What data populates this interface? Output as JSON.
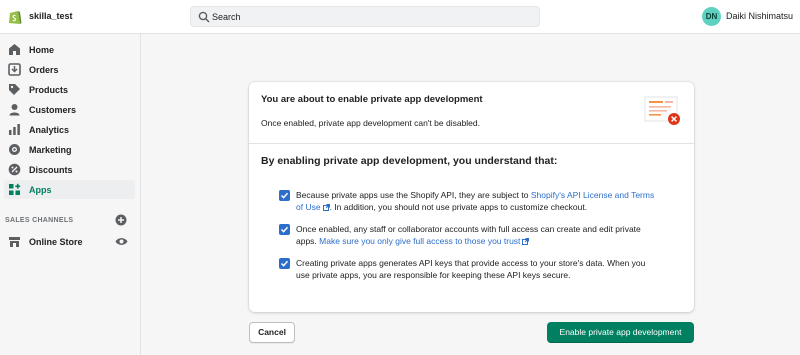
{
  "app": {
    "store_name": "skilla_test",
    "user_initials": "DN",
    "user_name": "Daiki Nishimatsu",
    "accent_color": "#008060",
    "link_color": "#2c6ecb"
  },
  "search": {
    "placeholder": "Search"
  },
  "sidebar": {
    "items": [
      {
        "label": "Home",
        "icon": "home-icon"
      },
      {
        "label": "Orders",
        "icon": "orders-icon"
      },
      {
        "label": "Products",
        "icon": "tag-icon"
      },
      {
        "label": "Customers",
        "icon": "person-icon"
      },
      {
        "label": "Analytics",
        "icon": "bar-chart-icon"
      },
      {
        "label": "Marketing",
        "icon": "megaphone-icon"
      },
      {
        "label": "Discounts",
        "icon": "discount-icon"
      },
      {
        "label": "Apps",
        "icon": "apps-icon",
        "active": true
      }
    ],
    "sales_channels_title": "SALES CHANNELS",
    "channels": [
      {
        "label": "Online Store",
        "icon": "store-icon"
      }
    ]
  },
  "card": {
    "title": "You are about to enable private app development",
    "subtitle": "Once enabled, private app development can't be disabled.",
    "section_heading": "By enabling private app development, you understand that:",
    "items": [
      {
        "checked": true,
        "text_before": "Because private apps use the Shopify API, they are subject to ",
        "link": "Shopify's API License and Terms of Use",
        "text_after": ". In addition, you should not use private apps to customize checkout."
      },
      {
        "checked": true,
        "text_before": "Once enabled, any staff or collaborator accounts with full access can create and edit private apps. ",
        "link": "Make sure you only give full access to those you trust",
        "text_after": ""
      },
      {
        "checked": true,
        "text_before": "Creating private apps generates API keys that provide access to your store's data. When you use private apps, you are responsible for keeping these API keys secure.",
        "link": "",
        "text_after": ""
      }
    ]
  },
  "actions": {
    "cancel_label": "Cancel",
    "enable_label": "Enable private app development"
  }
}
